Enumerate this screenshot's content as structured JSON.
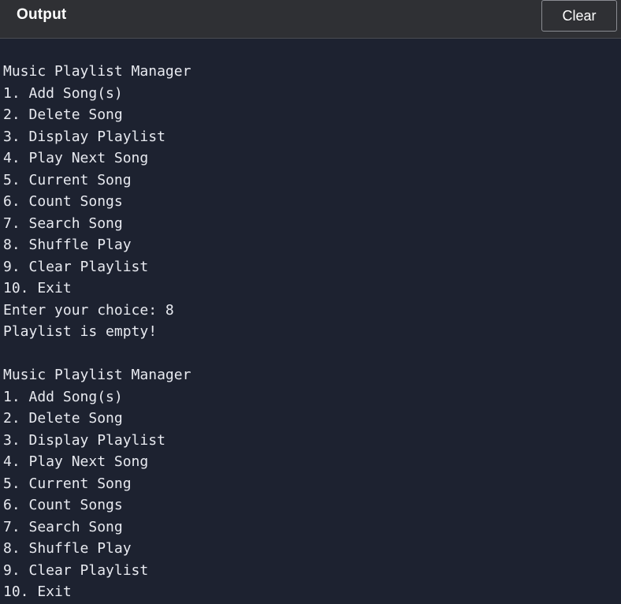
{
  "header": {
    "title": "Output",
    "clear_label": "Clear"
  },
  "output": {
    "lines": [
      "Music Playlist Manager",
      "1. Add Song(s)",
      "2. Delete Song",
      "3. Display Playlist",
      "4. Play Next Song",
      "5. Current Song",
      "6. Count Songs",
      "7. Search Song",
      "8. Shuffle Play",
      "9. Clear Playlist",
      "10. Exit",
      "Enter your choice: 8",
      "Playlist is empty!",
      "",
      "Music Playlist Manager",
      "1. Add Song(s)",
      "2. Delete Song",
      "3. Display Playlist",
      "4. Play Next Song",
      "5. Current Song",
      "6. Count Songs",
      "7. Search Song",
      "8. Shuffle Play",
      "9. Clear Playlist",
      "10. Exit"
    ]
  },
  "colors": {
    "header_bg": "#2f3034",
    "output_bg": "#1d2230",
    "text": "#e8eaf0"
  }
}
